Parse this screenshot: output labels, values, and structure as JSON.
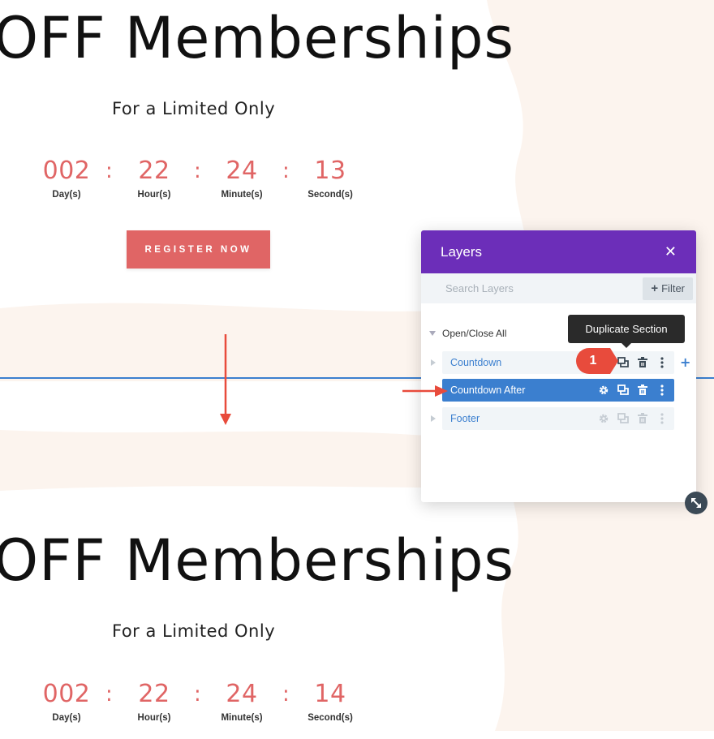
{
  "top_section": {
    "headline": "OFF Memberships",
    "subheading": "For a Limited Only",
    "countdown": [
      {
        "value": "002",
        "label": "Day(s)"
      },
      {
        "value": "22",
        "label": "Hour(s)"
      },
      {
        "value": "24",
        "label": "Minute(s)"
      },
      {
        "value": "13",
        "label": "Second(s)"
      }
    ],
    "separator": ":",
    "register_label": "REGISTER NOW"
  },
  "bottom_section": {
    "headline": "OFF Memberships",
    "subheading": "For a Limited Only",
    "countdown": [
      {
        "value": "002",
        "label": "Day(s)"
      },
      {
        "value": "22",
        "label": "Hour(s)"
      },
      {
        "value": "24",
        "label": "Minute(s)"
      },
      {
        "value": "14",
        "label": "Second(s)"
      }
    ],
    "separator": ":"
  },
  "layers_panel": {
    "title": "Layers",
    "close_icon": "close-icon",
    "search_placeholder": "Search Layers",
    "filter_label": "Filter",
    "open_close_label": "Open/Close All",
    "rows": [
      {
        "label": "Countdown"
      },
      {
        "label": "Countdown After"
      },
      {
        "label": "Footer"
      }
    ],
    "tooltip": "Duplicate Section",
    "step_badge": "1",
    "add_icon": "+"
  },
  "colors": {
    "accent_red": "#e06565",
    "panel_purple": "#6c2eb9",
    "selected_blue": "#3b7fcf",
    "annotation_red": "#e84b3c"
  }
}
